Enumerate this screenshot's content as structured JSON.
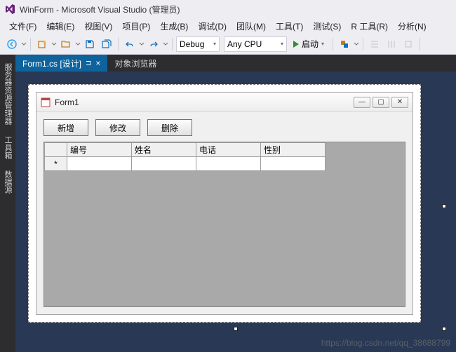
{
  "title": "WinForm - Microsoft Visual Studio (管理员)",
  "menu": {
    "file": "文件(F)",
    "edit": "编辑(E)",
    "view": "视图(V)",
    "project": "项目(P)",
    "build": "生成(B)",
    "debug": "调试(D)",
    "team": "团队(M)",
    "tools": "工具(T)",
    "test": "测试(S)",
    "rtools": "R 工具(R)",
    "analyze": "分析(N)"
  },
  "toolbar": {
    "config": "Debug",
    "platform": "Any CPU",
    "start": "启动"
  },
  "sidepanel": {
    "t1": "服务器资源管理器",
    "t2": "工具箱",
    "t3": "数据源"
  },
  "tabs": {
    "active": "Form1.cs [设计]",
    "inactive": "对象浏览器"
  },
  "form": {
    "title": "Form1",
    "btn_add": "新增",
    "btn_edit": "修改",
    "btn_del": "删除",
    "grid": {
      "c1": "编号",
      "c2": "姓名",
      "c3": "电话",
      "c4": "性别"
    },
    "row_marker": "*"
  },
  "watermark": "https://blog.csdn.net/qq_38688799"
}
